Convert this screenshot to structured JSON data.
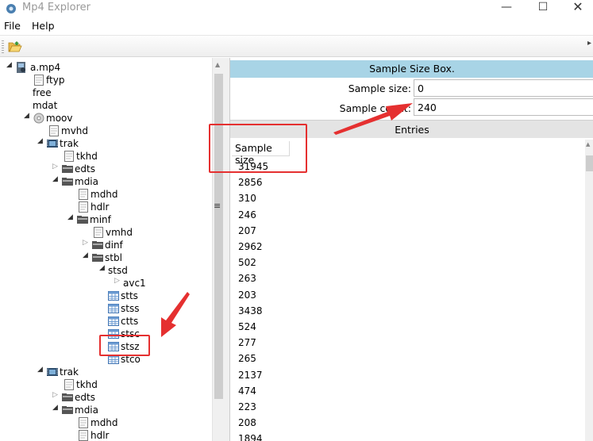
{
  "window": {
    "title": "Mp4 Explorer",
    "minimize": "—",
    "maximize": "☐",
    "close": "✕"
  },
  "menu": {
    "file": "File",
    "help": "Help"
  },
  "toolbar": {
    "open_icon": "folder-open-icon"
  },
  "tree": {
    "root": "a.mp4",
    "ftyp": "ftyp",
    "free": "free",
    "mdat": "mdat",
    "moov": "moov",
    "mvhd": "mvhd",
    "trak1": "trak",
    "tkhd1": "tkhd",
    "edts1": "edts",
    "mdia1": "mdia",
    "mdhd1": "mdhd",
    "hdlr1": "hdlr",
    "minf": "minf",
    "vmhd": "vmhd",
    "dinf": "dinf",
    "stbl": "stbl",
    "stsd": "stsd",
    "avc1": "avc1",
    "stts": "stts",
    "stss": "stss",
    "ctts": "ctts",
    "stsc": "stsc",
    "stsz": "stsz",
    "stco": "stco",
    "trak2": "trak",
    "tkhd2": "tkhd",
    "edts2": "edts",
    "mdia2": "mdia",
    "mdhd2": "mdhd",
    "hdlr2": "hdlr"
  },
  "detail": {
    "title": "Sample Size Box.",
    "sample_size_label": "Sample size:",
    "sample_size_value": "0",
    "sample_count_label": "Sample count:",
    "sample_count_value": "240",
    "entries_label": "Entries",
    "column_header": "Sample size",
    "rows": [
      "31945",
      "2856",
      "310",
      "246",
      "207",
      "2962",
      "502",
      "263",
      "203",
      "3438",
      "524",
      "277",
      "265",
      "2137",
      "474",
      "223",
      "208",
      "1894"
    ]
  },
  "annotation_color": "#e53030"
}
